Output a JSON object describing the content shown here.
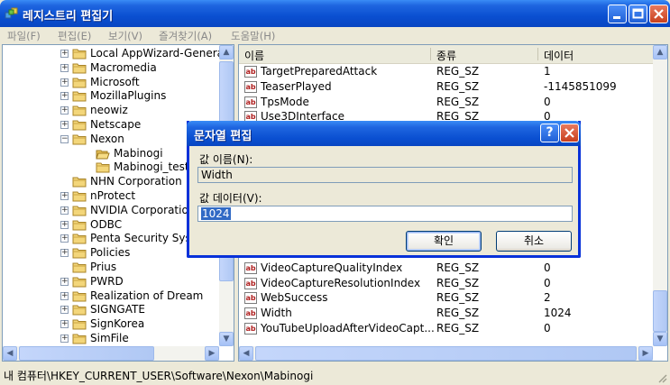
{
  "window": {
    "title": "레지스트리 편집기"
  },
  "menu": [
    "파일(F)",
    "편집(E)",
    "보기(V)",
    "즐겨찾기(A)",
    "도움말(H)"
  ],
  "tree": [
    {
      "label": "Local AppWizard-Genera",
      "expander": "+",
      "indent": 0
    },
    {
      "label": "Macromedia",
      "expander": "+",
      "indent": 0
    },
    {
      "label": "Microsoft",
      "expander": "+",
      "indent": 0
    },
    {
      "label": "MozillaPlugins",
      "expander": "+",
      "indent": 0
    },
    {
      "label": "neowiz",
      "expander": "+",
      "indent": 0
    },
    {
      "label": "Netscape",
      "expander": "+",
      "indent": 0
    },
    {
      "label": "Nexon",
      "expander": "−",
      "indent": 0
    },
    {
      "label": "Mabinogi",
      "expander": "",
      "indent": 1,
      "open": true
    },
    {
      "label": "Mabinogi_test",
      "expander": "",
      "indent": 1
    },
    {
      "label": "NHN Corporation",
      "expander": "",
      "indent": 0
    },
    {
      "label": "nProtect",
      "expander": "+",
      "indent": 0
    },
    {
      "label": "NVIDIA Corporation",
      "expander": "+",
      "indent": 0
    },
    {
      "label": "ODBC",
      "expander": "+",
      "indent": 0
    },
    {
      "label": "Penta Security Sys",
      "expander": "+",
      "indent": 0
    },
    {
      "label": "Policies",
      "expander": "+",
      "indent": 0
    },
    {
      "label": "Prius",
      "expander": "",
      "indent": 0
    },
    {
      "label": "PWRD",
      "expander": "+",
      "indent": 0
    },
    {
      "label": "Realization of Dream",
      "expander": "+",
      "indent": 0
    },
    {
      "label": "SIGNGATE",
      "expander": "+",
      "indent": 0
    },
    {
      "label": "SignKorea",
      "expander": "+",
      "indent": 0
    },
    {
      "label": "SimFile",
      "expander": "+",
      "indent": 0
    }
  ],
  "list": {
    "headers": {
      "name": "이름",
      "type": "종류",
      "data": "데이터"
    },
    "rows": [
      {
        "name": "TargetPreparedAttack",
        "type": "REG_SZ",
        "data": "1"
      },
      {
        "name": "TeaserPlayed",
        "type": "REG_SZ",
        "data": "-1145851099"
      },
      {
        "name": "TpsMode",
        "type": "REG_SZ",
        "data": "0"
      },
      {
        "name": "Use3DInterface",
        "type": "REG_SZ",
        "data": "0"
      },
      {
        "name": "",
        "type": "",
        "data": ""
      },
      {
        "name": "",
        "type": "",
        "data": ""
      },
      {
        "name": "",
        "type": "",
        "data": ""
      },
      {
        "name": "",
        "type": "",
        "data": ""
      },
      {
        "name": "",
        "type": "",
        "data": ""
      },
      {
        "name": "",
        "type": "",
        "data": ""
      },
      {
        "name": "",
        "type": "",
        "data": ""
      },
      {
        "name": "",
        "type": "",
        "data": ""
      },
      {
        "name": "",
        "type": "",
        "data": ""
      },
      {
        "name": "VideoCaptureQualityIndex",
        "type": "REG_SZ",
        "data": "0"
      },
      {
        "name": "VideoCaptureResolutionIndex",
        "type": "REG_SZ",
        "data": "0"
      },
      {
        "name": "WebSuccess",
        "type": "REG_SZ",
        "data": "2"
      },
      {
        "name": "Width",
        "type": "REG_SZ",
        "data": "1024"
      },
      {
        "name": "YouTubeUploadAfterVideoCapt...",
        "type": "REG_SZ",
        "data": "0"
      }
    ]
  },
  "status": {
    "path": "내 컴퓨터\\HKEY_CURRENT_USER\\Software\\Nexon\\Mabinogi"
  },
  "dialog": {
    "title": "문자열 편집",
    "name_label": "값 이름(N):",
    "name_value": "Width",
    "data_label": "값 데이터(V):",
    "data_value": "1024",
    "ok": "확인",
    "cancel": "취소"
  },
  "colors": {
    "titlebar": "#0A4FD1",
    "selection": "#316AC5",
    "folder": "#F3D67A"
  }
}
